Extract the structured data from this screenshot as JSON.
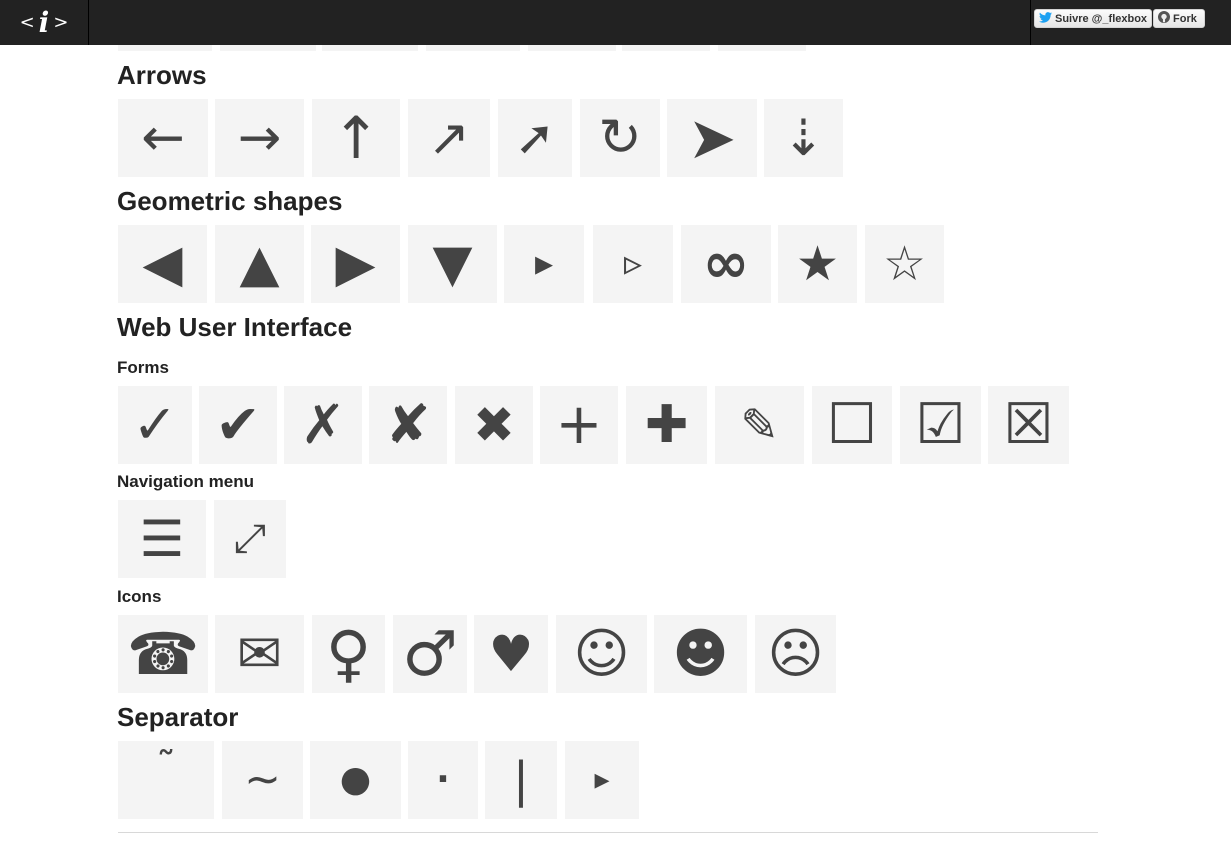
{
  "topbar": {
    "logo_left": "<",
    "logo_mid": "i",
    "logo_right": ">",
    "twitter_label": "Suivre @_flexbox",
    "fork_label": "Fork",
    "twitter_color": "#1da1f2"
  },
  "sections": {
    "arrows": {
      "title": "Arrows",
      "glyphs": [
        "←",
        "→",
        "↑",
        "↗",
        "➚",
        "↻",
        "➤",
        "⇣"
      ]
    },
    "geometric": {
      "title": "Geometric shapes",
      "glyphs": [
        "◀",
        "▲",
        "▶",
        "▼",
        "▸",
        "▹",
        "∞",
        "★",
        "☆"
      ]
    },
    "web_ui": {
      "title": "Web User Interface",
      "forms": {
        "title": "Forms",
        "glyphs": [
          "✓",
          "✔",
          "✗",
          "✘",
          "✖",
          "+",
          "✚",
          "✎",
          "☐",
          "☑",
          "☒"
        ]
      },
      "nav": {
        "title": "Navigation menu",
        "glyphs": [
          "☰",
          "⤢"
        ]
      },
      "icons": {
        "title": "Icons",
        "glyphs": [
          "☎",
          "✉",
          "♀",
          "♂",
          "♥",
          "☺",
          "☻",
          "☹"
        ]
      }
    },
    "separator": {
      "title": "Separator",
      "glyphs": [
        "˜",
        "∼",
        "●",
        "·",
        "|",
        "▸"
      ]
    }
  },
  "colors": {
    "topbar_bg": "#222222",
    "tile_bg": "#f4f4f4",
    "glyph": "#444444"
  }
}
